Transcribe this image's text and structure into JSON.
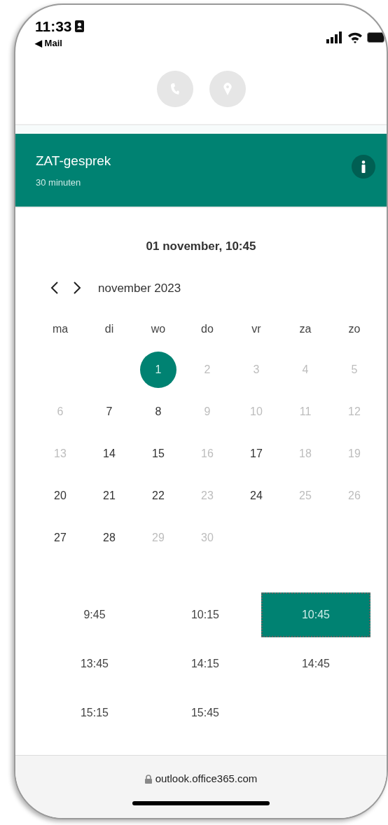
{
  "status_bar": {
    "time": "11:33",
    "back_label": "◀ Mail"
  },
  "contact_buttons": [
    {
      "kind": "phone"
    },
    {
      "kind": "location"
    }
  ],
  "service": {
    "title": "ZAT-gesprek",
    "duration": "30 minuten"
  },
  "selected_datetime": "01 november, 10:45",
  "calendar": {
    "month": "november 2023",
    "weekdays": [
      "ma",
      "di",
      "wo",
      "do",
      "vr",
      "za",
      "zo"
    ],
    "weeks": [
      [
        {
          "day": "1",
          "available": true,
          "selected": true
        },
        {
          "day": "2",
          "available": false,
          "selected": false
        },
        {
          "day": "3",
          "available": false,
          "selected": false
        },
        {
          "day": "4",
          "available": false,
          "selected": false
        },
        {
          "day": "5",
          "available": false,
          "selected": false
        }
      ],
      [
        {
          "day": "6",
          "available": false,
          "selected": false
        },
        {
          "day": "7",
          "available": true,
          "selected": false
        },
        {
          "day": "8",
          "available": true,
          "selected": false
        },
        {
          "day": "9",
          "available": false,
          "selected": false
        },
        {
          "day": "10",
          "available": false,
          "selected": false
        },
        {
          "day": "11",
          "available": false,
          "selected": false
        },
        {
          "day": "12",
          "available": false,
          "selected": false
        }
      ],
      [
        {
          "day": "13",
          "available": false,
          "selected": false
        },
        {
          "day": "14",
          "available": true,
          "selected": false
        },
        {
          "day": "15",
          "available": true,
          "selected": false
        },
        {
          "day": "16",
          "available": false,
          "selected": false
        },
        {
          "day": "17",
          "available": true,
          "selected": false
        },
        {
          "day": "18",
          "available": false,
          "selected": false
        },
        {
          "day": "19",
          "available": false,
          "selected": false
        }
      ],
      [
        {
          "day": "20",
          "available": true,
          "selected": false
        },
        {
          "day": "21",
          "available": true,
          "selected": false
        },
        {
          "day": "22",
          "available": true,
          "selected": false
        },
        {
          "day": "23",
          "available": false,
          "selected": false
        },
        {
          "day": "24",
          "available": true,
          "selected": false
        },
        {
          "day": "25",
          "available": false,
          "selected": false
        },
        {
          "day": "26",
          "available": false,
          "selected": false
        }
      ],
      [
        {
          "day": "27",
          "available": true,
          "selected": false
        },
        {
          "day": "28",
          "available": true,
          "selected": false
        },
        {
          "day": "29",
          "available": false,
          "selected": false
        },
        {
          "day": "30",
          "available": false,
          "selected": false
        }
      ]
    ]
  },
  "time_slots": [
    {
      "label": "9:45",
      "selected": false
    },
    {
      "label": "10:15",
      "selected": false
    },
    {
      "label": "10:45",
      "selected": true
    },
    {
      "label": "13:45",
      "selected": false
    },
    {
      "label": "14:15",
      "selected": false
    },
    {
      "label": "14:45",
      "selected": false
    },
    {
      "label": "15:15",
      "selected": false
    },
    {
      "label": "15:45",
      "selected": false
    }
  ],
  "address_bar": {
    "url": "outlook.office365.com"
  }
}
